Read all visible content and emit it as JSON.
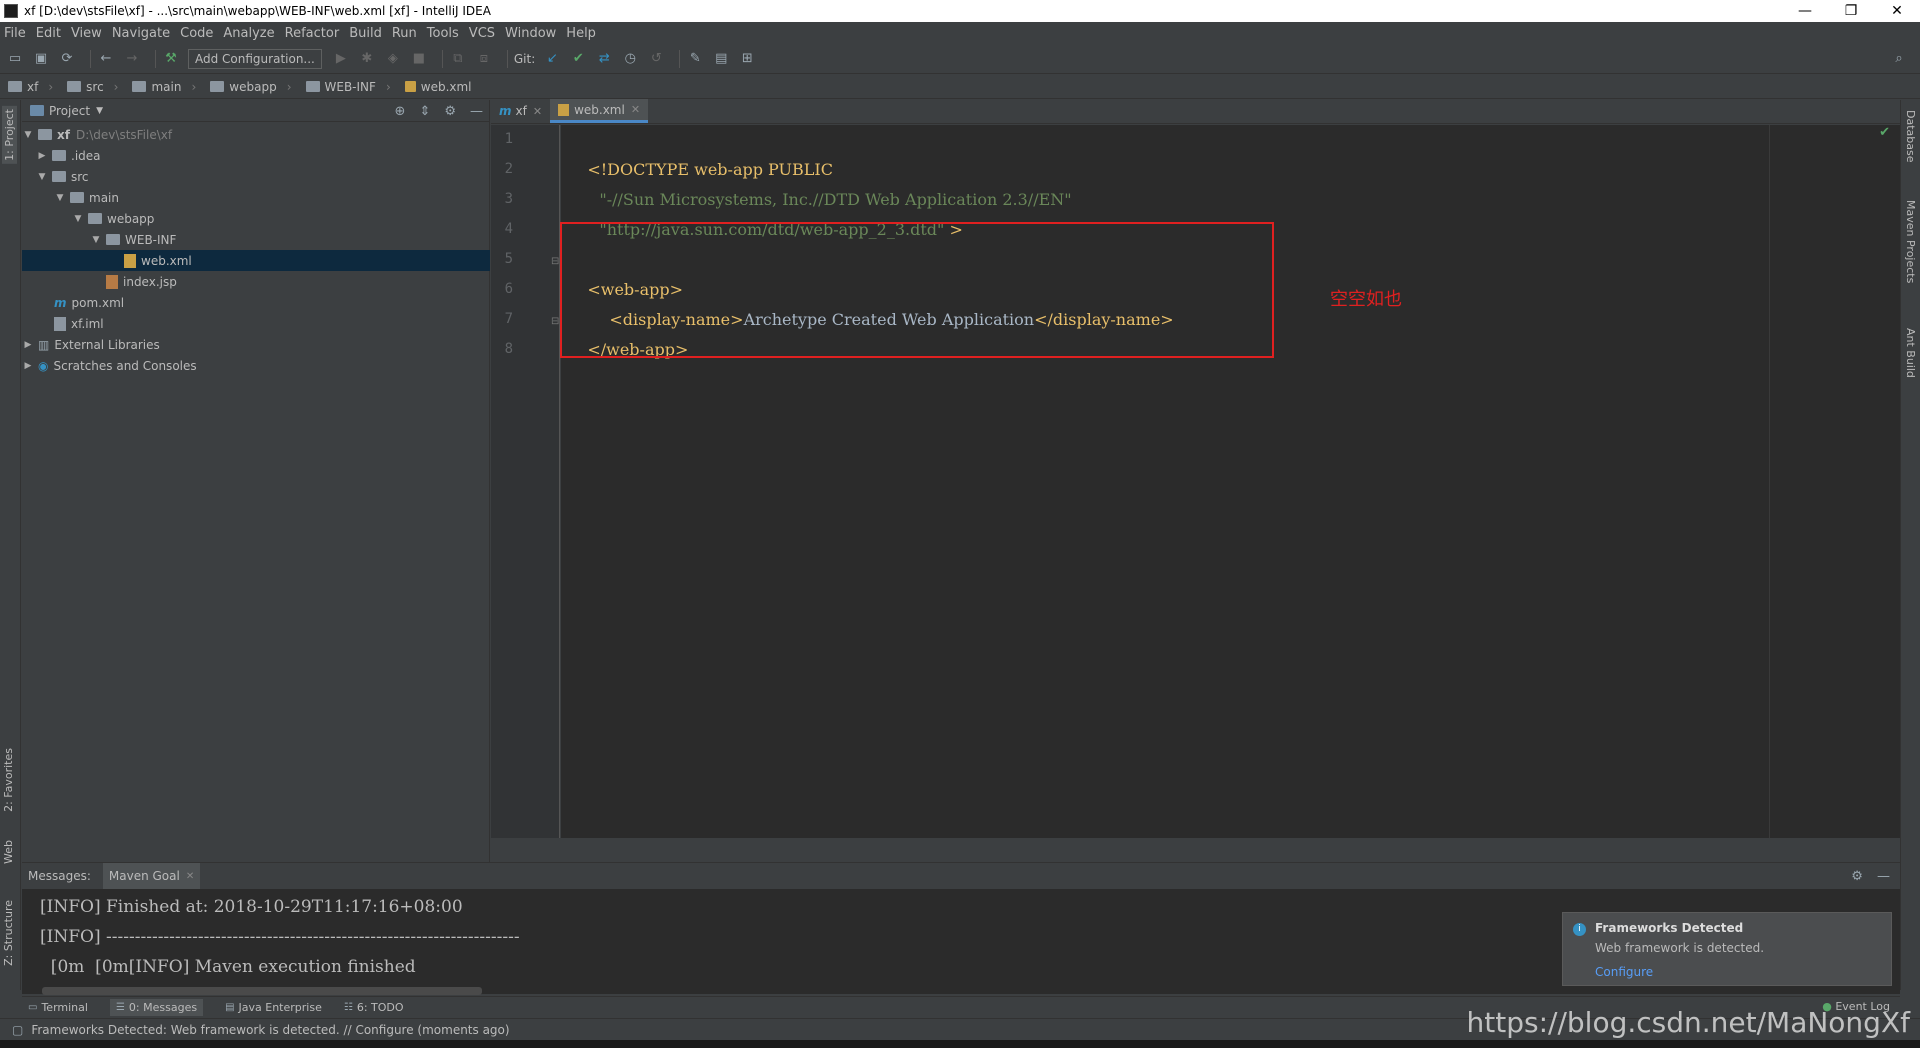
{
  "window": {
    "title": "xf [D:\\dev\\stsFile\\xf] - ...\\src\\main\\webapp\\WEB-INF\\web.xml [xf] - IntelliJ IDEA"
  },
  "menu": [
    "File",
    "Edit",
    "View",
    "Navigate",
    "Code",
    "Analyze",
    "Refactor",
    "Build",
    "Run",
    "Tools",
    "VCS",
    "Window",
    "Help"
  ],
  "toolbar": {
    "add_config": "Add Configuration...",
    "git_label": "Git:"
  },
  "breadcrumbs": [
    "xf",
    "src",
    "main",
    "webapp",
    "WEB-INF",
    "web.xml"
  ],
  "left_tabs": {
    "project": "1: Project",
    "favorites": "2: Favorites",
    "web": "Web",
    "structure": "Z: Structure"
  },
  "right_tabs": {
    "database": "Database",
    "maven": "Maven Projects",
    "ant": "Ant Build"
  },
  "project_panel": {
    "title": "Project",
    "tree": [
      {
        "label": "xf",
        "path": "D:\\dev\\stsFile\\xf",
        "arrow": "▼",
        "indent": 0
      },
      {
        "label": ".idea",
        "arrow": "▶",
        "indent": 1
      },
      {
        "label": "src",
        "arrow": "▼",
        "indent": 1
      },
      {
        "label": "main",
        "arrow": "▼",
        "indent": 2
      },
      {
        "label": "webapp",
        "arrow": "▼",
        "indent": 3
      },
      {
        "label": "WEB-INF",
        "arrow": "▼",
        "indent": 4
      },
      {
        "label": "web.xml",
        "arrow": "",
        "indent": 5
      },
      {
        "label": "index.jsp",
        "arrow": "",
        "indent": 4
      },
      {
        "label": "pom.xml",
        "arrow": "",
        "indent": 1
      },
      {
        "label": "xf.iml",
        "arrow": "",
        "indent": 1
      },
      {
        "label": "External Libraries",
        "arrow": "▶",
        "indent": 0
      },
      {
        "label": "Scratches and Consoles",
        "arrow": "▶",
        "indent": 0
      }
    ]
  },
  "editor_tabs": [
    {
      "label": "xf",
      "active": false
    },
    {
      "label": "web.xml",
      "active": true
    }
  ],
  "editor": {
    "line_numbers": [
      "1",
      "2",
      "3",
      "4",
      "5",
      "6",
      "7",
      "8"
    ],
    "line1": {
      "a": "<!DOCTYPE web-app PUBLIC"
    },
    "line2": {
      "a": "\"-//Sun Microsystems, Inc.//DTD Web Application 2.3//EN\""
    },
    "line3": {
      "a": "\"http://java.sun.com/dtd/web-app_2_3.dtd\"",
      "b": " >"
    },
    "line5": {
      "a": "<web-app>"
    },
    "line6": {
      "a": "<display-name>",
      "b": "Archetype Created Web Application",
      "c": "</display-name>"
    },
    "line7": {
      "a": "</web-app>"
    }
  },
  "annotation": "空空如也",
  "messages": {
    "label": "Messages:",
    "tab": "Maven Goal",
    "lines": [
      "[INFO] Finished at: 2018-10-29T11:17:16+08:00",
      "[INFO] ------------------------------------------------------------------------",
      "  [0m  [0m[INFO] Maven execution finished"
    ]
  },
  "notification": {
    "title": "Frameworks Detected",
    "body": "Web framework is detected.",
    "link": "Configure"
  },
  "bottom_tabs": [
    "Terminal",
    "0: Messages",
    "Java Enterprise",
    "6: TODO"
  ],
  "event_log": "Event Log",
  "status": "Frameworks Detected: Web framework is detected. // Configure (moments ago)",
  "watermark": "https://blog.csdn.net/MaNongXf",
  "colors": {
    "accent": "#4a88c7",
    "annotation": "#e02020",
    "editor_bg": "#2b2b2b",
    "panel_bg": "#3c3f41"
  }
}
